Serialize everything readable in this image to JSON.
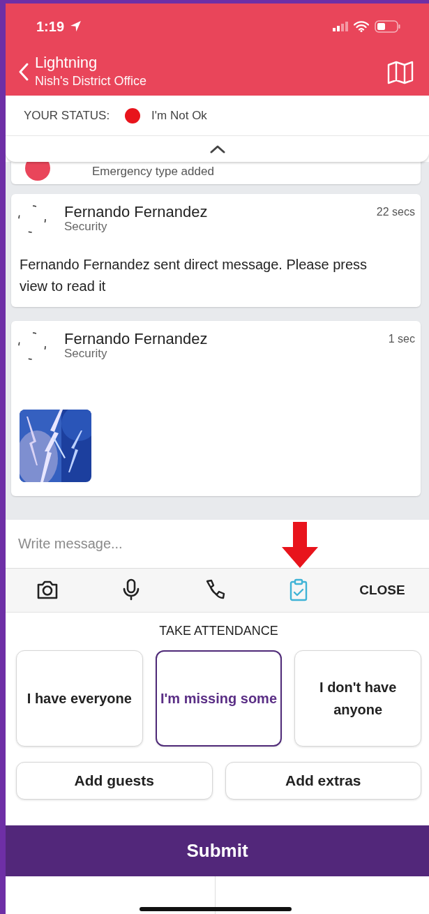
{
  "status_bar": {
    "time": "1:19"
  },
  "header": {
    "title": "Lightning",
    "subtitle": "Nish's District Office"
  },
  "your_status": {
    "label": "YOUR STATUS:",
    "text": "I'm Not Ok"
  },
  "feed": [
    {
      "kind": "partial",
      "text": "Emergency type added"
    },
    {
      "kind": "text",
      "name": "Fernando Fernandez",
      "role": "Security",
      "time": "22 secs",
      "body": "Fernando Fernandez sent direct message. Please press view to read it"
    },
    {
      "name": "Fernando Fernandez",
      "role": "Security",
      "time": "1 sec"
    }
  ],
  "composer": {
    "placeholder": "Write message..."
  },
  "toolbar": {
    "tools": [
      {
        "kind": "camera",
        "selected": false
      },
      {
        "kind": "mic",
        "selected": false
      },
      {
        "kind": "phone",
        "selected": false
      },
      {
        "kind": "attendance",
        "selected": true
      }
    ],
    "close": "CLOSE"
  },
  "attendance": {
    "title": "TAKE ATTENDANCE",
    "options": [
      {
        "label": "I have everyone",
        "selected": false
      },
      {
        "label": "I'm missing some",
        "selected": true
      },
      {
        "label": "I don't have anyone",
        "selected": false
      }
    ],
    "actions": [
      "Add guests",
      "Add extras"
    ]
  },
  "submit": "Submit"
}
